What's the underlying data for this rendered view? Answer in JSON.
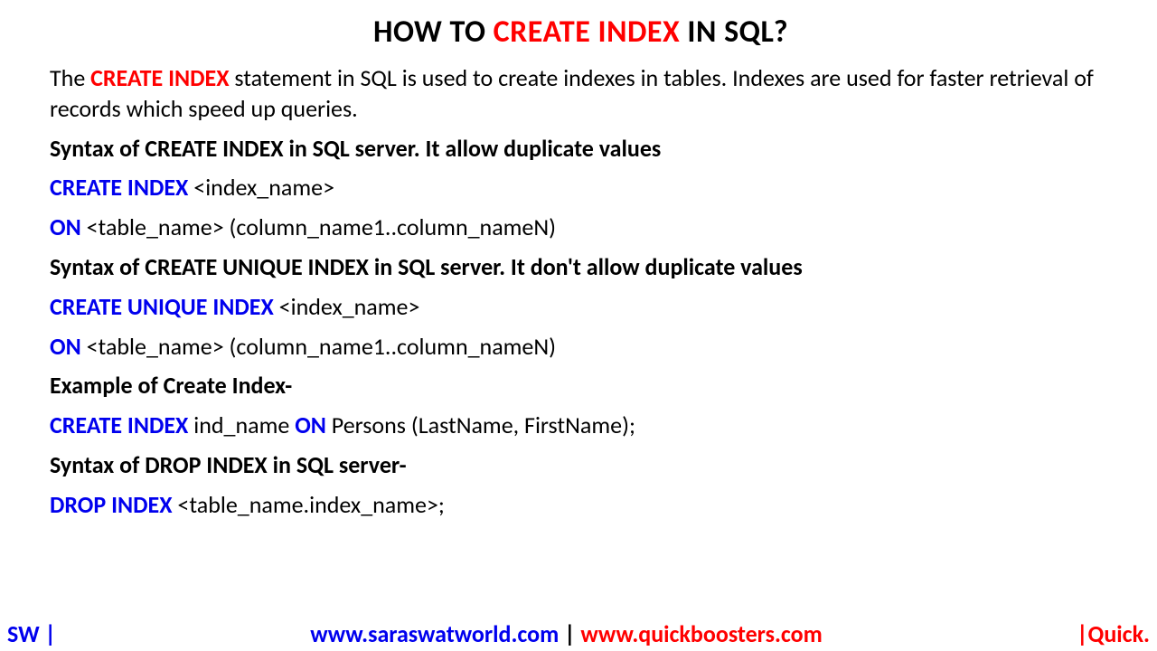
{
  "title": {
    "p1": "HOW TO ",
    "p2": "CREATE INDEX",
    "p3": " IN SQL?"
  },
  "intro": {
    "p1": "The ",
    "p2": "CREATE INDEX",
    "p3": " statement in SQL is used to create indexes in tables. Indexes are used for faster retrieval of records which speed up queries."
  },
  "syntax1_heading": "Syntax of CREATE INDEX in SQL server. It allow duplicate values",
  "syntax1_line1": {
    "kw": "CREATE INDEX",
    "rest": " <index_name>"
  },
  "syntax1_line2": {
    "kw": "ON",
    "rest": " <table_name> (column_name1..column_nameN)"
  },
  "syntax2_heading": "Syntax of CREATE UNIQUE INDEX in SQL server. It don't allow duplicate values",
  "syntax2_line1": {
    "kw": "CREATE UNIQUE INDEX",
    "rest": " <index_name>"
  },
  "syntax2_line2": {
    "kw": "ON",
    "rest": " <table_name> (column_name1..column_nameN)"
  },
  "example_heading": "Example of Create Index-",
  "example_line": {
    "kw1": "CREATE INDEX",
    "mid1": " ind_name ",
    "kw2": "ON",
    "mid2": " Persons (LastName, FirstName);"
  },
  "drop_heading": "Syntax of DROP INDEX in SQL server-",
  "drop_line": {
    "kw": "DROP INDEX",
    "rest": " <table_name.index_name>;"
  },
  "footer": {
    "left": "SW |",
    "site1": "www.saraswatworld.com",
    "pipe": " | ",
    "site2": "www.quickboosters.com",
    "right": "|Quick."
  }
}
